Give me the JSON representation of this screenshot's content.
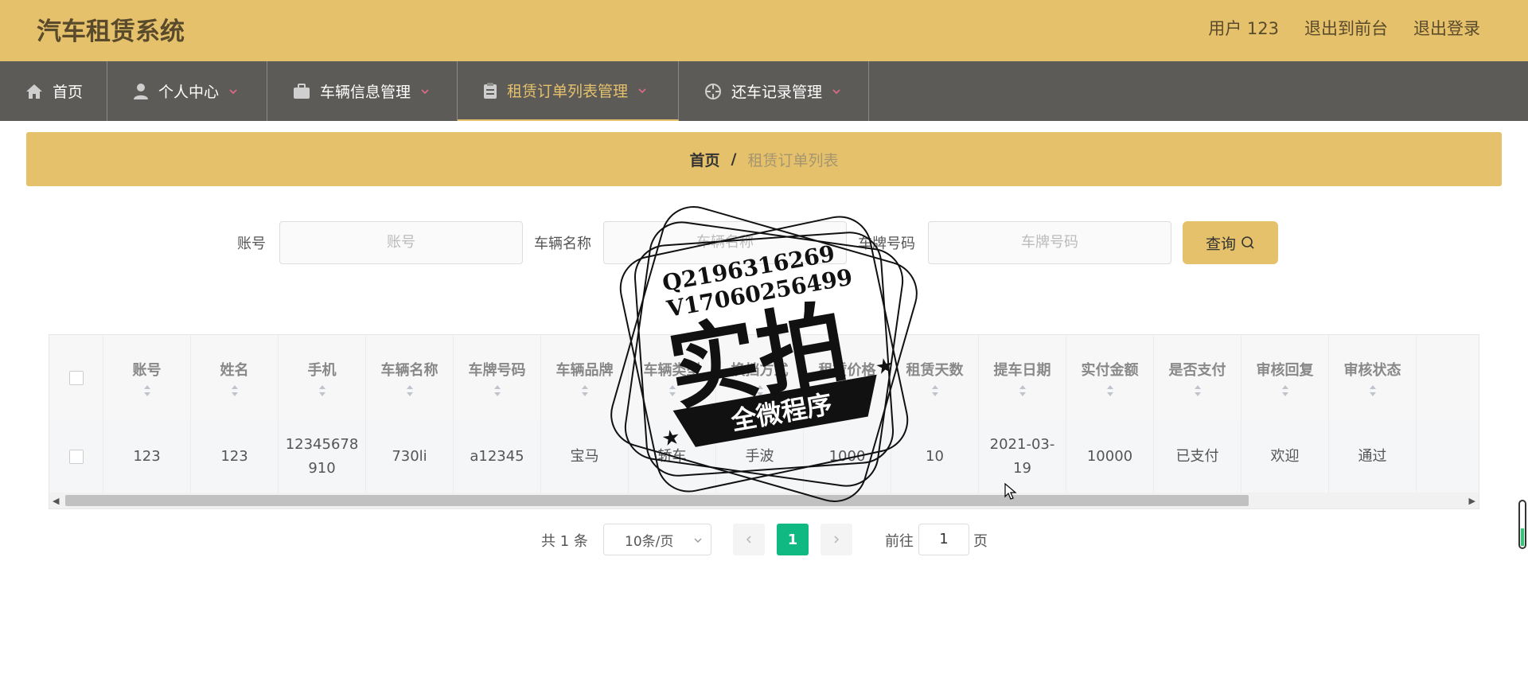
{
  "app": {
    "title": "汽车租赁系统"
  },
  "header": {
    "user": "用户 123",
    "to_front": "退出到前台",
    "logout": "退出登录"
  },
  "nav": [
    {
      "label": "首页",
      "icon": "home-icon"
    },
    {
      "label": "个人中心",
      "icon": "user-icon"
    },
    {
      "label": "车辆信息管理",
      "icon": "briefcase-icon"
    },
    {
      "label": "租赁订单列表管理",
      "icon": "clipboard-icon"
    },
    {
      "label": "还车记录管理",
      "icon": "crosshair-icon"
    }
  ],
  "breadcrumb": {
    "home": "首页",
    "sep": "/",
    "current": "租赁订单列表"
  },
  "search": {
    "fields": [
      {
        "label": "账号",
        "placeholder": "账号"
      },
      {
        "label": "车辆名称",
        "placeholder": "车辆名称"
      },
      {
        "label": "车牌号码",
        "placeholder": "车牌号码"
      }
    ],
    "button": "查询"
  },
  "table": {
    "columns": [
      "账号",
      "姓名",
      "手机",
      "车辆名称",
      "车牌号码",
      "车辆品牌",
      "车辆类型",
      "换挡方式",
      "租赁价格",
      "租赁天数",
      "提车日期",
      "实付金额",
      "是否支付",
      "审核回复",
      "审核状态"
    ],
    "rows": [
      [
        "123",
        "123",
        "12345678910",
        "730li",
        "a12345",
        "宝马",
        "轿车",
        "手波",
        "1000",
        "10",
        "2021-03-19",
        "10000",
        "已支付",
        "欢迎",
        "通过"
      ]
    ]
  },
  "pagination": {
    "total": "共 1 条",
    "page_size": "10条/页",
    "current_page": "1",
    "goto_label": "前往",
    "goto_value": "1",
    "unit": "页"
  },
  "watermark": {
    "line1": "Q2196316269",
    "line2": "V17060256499",
    "main": "实拍",
    "ribbon": "全微程序"
  }
}
